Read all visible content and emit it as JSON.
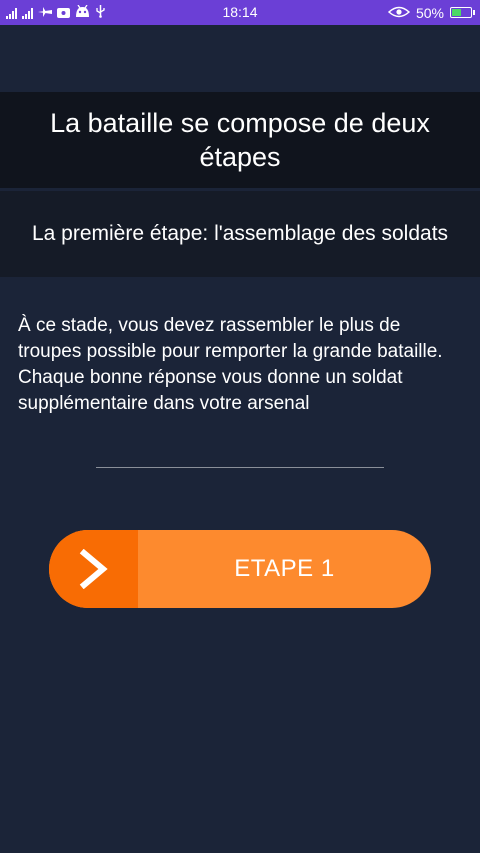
{
  "status_bar": {
    "time": "18:14",
    "battery_percent_label": "50%",
    "battery_level": 0.5,
    "left_icons": [
      "signal-icon",
      "signal-icon",
      "airplane-icon",
      "message-icon",
      "android-icon",
      "usb-icon"
    ],
    "right_icons": [
      "eye-icon",
      "battery-icon"
    ],
    "color": "#6b3fd6"
  },
  "header": {
    "title": "La bataille se compose de deux étapes",
    "subtitle": "La première étape: l'assemblage des soldats"
  },
  "body": {
    "paragraph_1": "À ce stade, vous devez rassembler le plus de troupes possible pour remporter la grande bataille.",
    "paragraph_2": "Chaque bonne réponse vous donne un soldat supplémentaire dans votre arsenal"
  },
  "step_button": {
    "label": "ETAPE 1",
    "icon": "chevron-right-icon",
    "color": "#fd8a2e",
    "accent_color": "#f86c04"
  },
  "background_color": "#1b2438"
}
